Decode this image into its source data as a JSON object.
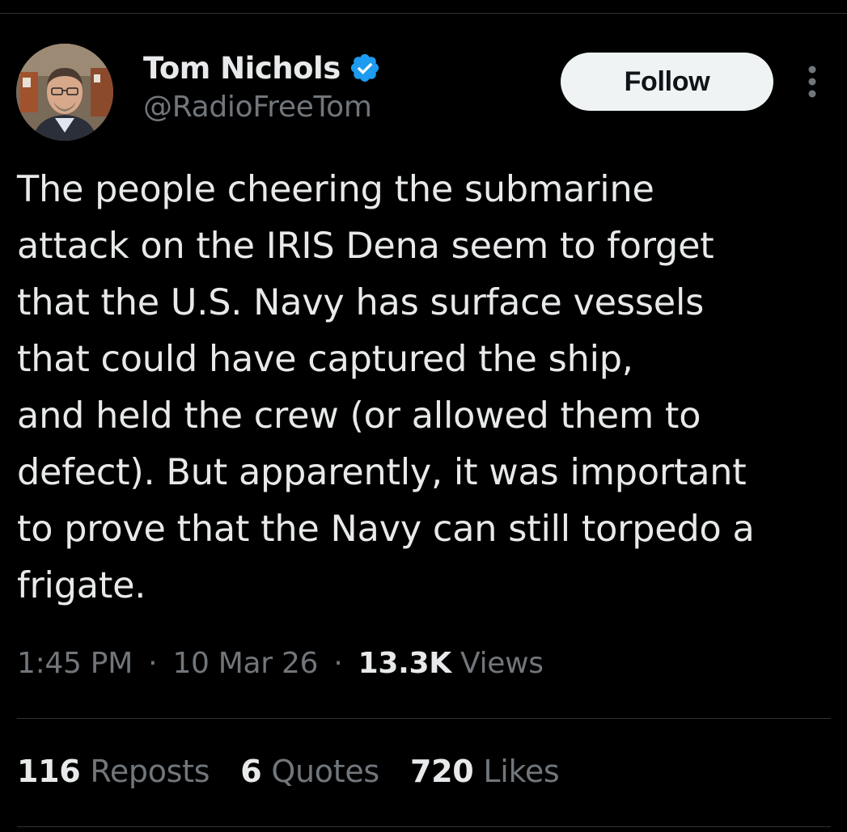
{
  "author": {
    "display_name": "Tom Nichols",
    "handle": "@RadioFreeTom",
    "verified_icon": "verified-badge-icon",
    "avatar_icon": "avatar-photo"
  },
  "actions": {
    "follow_label": "Follow",
    "more_icon": "more-options-icon"
  },
  "tweet": {
    "text": "The people cheering the submarine\nattack on the IRIS Dena seem to forget\nthat the U.S. Navy has surface vessels\nthat could have captured the ship,\nand held the crew (or allowed them to\ndefect). But apparently, it was important\nto prove that the Navy can still torpedo a\nfrigate."
  },
  "meta": {
    "time": "1:45 PM",
    "date": "10 Mar 26",
    "separator": "·",
    "views_count": "13.3K",
    "views_label": "Views"
  },
  "stats": [
    {
      "count": "116",
      "label": "Reposts"
    },
    {
      "count": "6",
      "label": "Quotes"
    },
    {
      "count": "720",
      "label": "Likes"
    }
  ],
  "colors": {
    "background": "#000000",
    "primary_text": "#e7e9ea",
    "secondary_text": "#71767b",
    "verified_blue": "#1d9bf0",
    "divider": "#2f3336",
    "button_bg": "#eff3f4"
  }
}
